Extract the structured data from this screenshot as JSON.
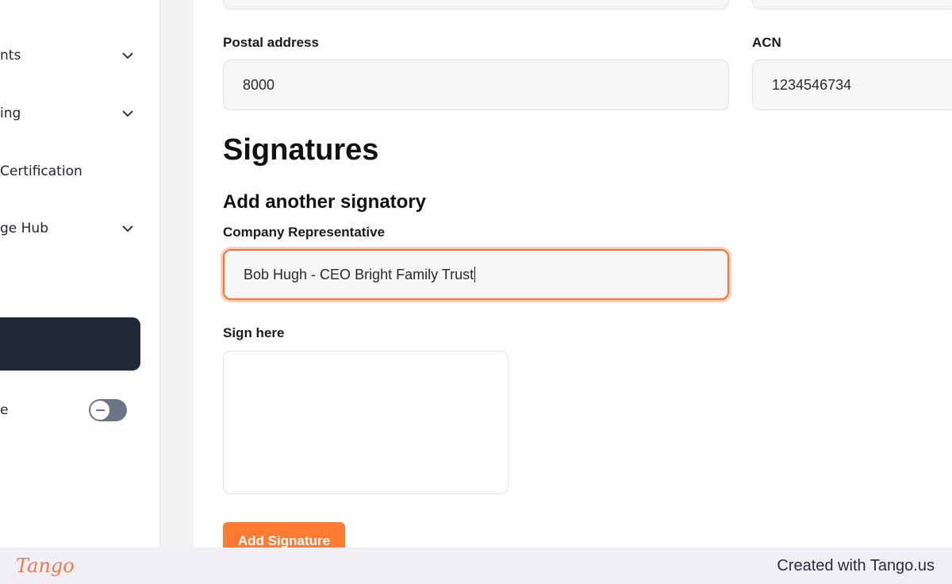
{
  "sidebar": {
    "items": [
      {
        "label": "nts",
        "has_chevron": true
      },
      {
        "label": "ing",
        "has_chevron": true
      },
      {
        "label": " Certification",
        "has_chevron": false
      },
      {
        "label": "ge Hub",
        "has_chevron": true
      }
    ],
    "toggle_label": "e",
    "toggle_icon": "minus-icon"
  },
  "form": {
    "postal_address": {
      "label": "Postal address",
      "value": "8000"
    },
    "acn": {
      "label": "ACN",
      "value": "1234546734"
    },
    "signatures_heading": "Signatures",
    "add_signatory_heading": "Add another signatory",
    "company_rep": {
      "label": "Company Representative",
      "value": "Bob Hugh - CEO Bright Family Trust"
    },
    "sign_here_label": "Sign here",
    "add_signature_button": "Add Signature"
  },
  "footer": {
    "logo_text": "Tango",
    "credit_text": "Created with Tango.us"
  },
  "colors": {
    "accent": "#ff7a33",
    "sidebar_dark": "#1f2937",
    "focus_ring": "#ff7433"
  }
}
